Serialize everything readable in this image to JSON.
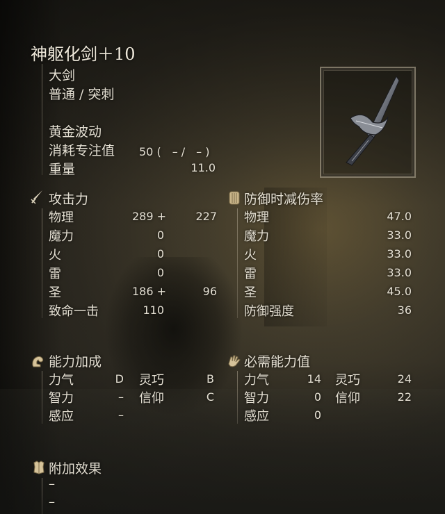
{
  "weapon": {
    "name": "神躯化剑＋10",
    "type": "大剑",
    "attack_type": "普通 / 突刺",
    "skill": "黄金波动",
    "fp_label": "消耗专注值",
    "fp_value": "50 (　– /　– )",
    "weight_label": "重量",
    "weight_value": "11.0"
  },
  "attack": {
    "title": "攻击力",
    "rows": [
      {
        "label": "物理",
        "base": "289 +",
        "bonus": "227"
      },
      {
        "label": "魔力",
        "base": "0",
        "bonus": ""
      },
      {
        "label": "火",
        "base": "0",
        "bonus": ""
      },
      {
        "label": "雷",
        "base": "0",
        "bonus": ""
      },
      {
        "label": "圣",
        "base": "186 +",
        "bonus": "96"
      },
      {
        "label": "致命一击",
        "base": "110",
        "bonus": ""
      }
    ]
  },
  "guard": {
    "title": "防御时减伤率",
    "rows": [
      {
        "label": "物理",
        "value": "47.0"
      },
      {
        "label": "魔力",
        "value": "33.0"
      },
      {
        "label": "火",
        "value": "33.0"
      },
      {
        "label": "雷",
        "value": "33.0"
      },
      {
        "label": "圣",
        "value": "45.0"
      },
      {
        "label": "防御强度",
        "value": "36"
      }
    ]
  },
  "scaling": {
    "title": "能力加成",
    "rows": [
      {
        "l1": "力气",
        "v1": "D",
        "l2": "灵巧",
        "v2": "B"
      },
      {
        "l1": "智力",
        "v1": "–",
        "l2": "信仰",
        "v2": "C"
      },
      {
        "l1": "感应",
        "v1": "–",
        "l2": "",
        "v2": ""
      }
    ]
  },
  "requirements": {
    "title": "必需能力值",
    "rows": [
      {
        "l1": "力气",
        "v1": "14",
        "l2": "灵巧",
        "v2": "24"
      },
      {
        "l1": "智力",
        "v1": "0",
        "l2": "信仰",
        "v2": "22"
      },
      {
        "l1": "感应",
        "v1": "0",
        "l2": "",
        "v2": ""
      }
    ]
  },
  "effects": {
    "title": "附加效果",
    "items": [
      "–",
      "–"
    ]
  },
  "icons": {
    "attack": "sword-icon",
    "guard": "shield-icon",
    "scaling": "arm-icon",
    "requirements": "hand-icon",
    "effects": "armor-icon"
  }
}
